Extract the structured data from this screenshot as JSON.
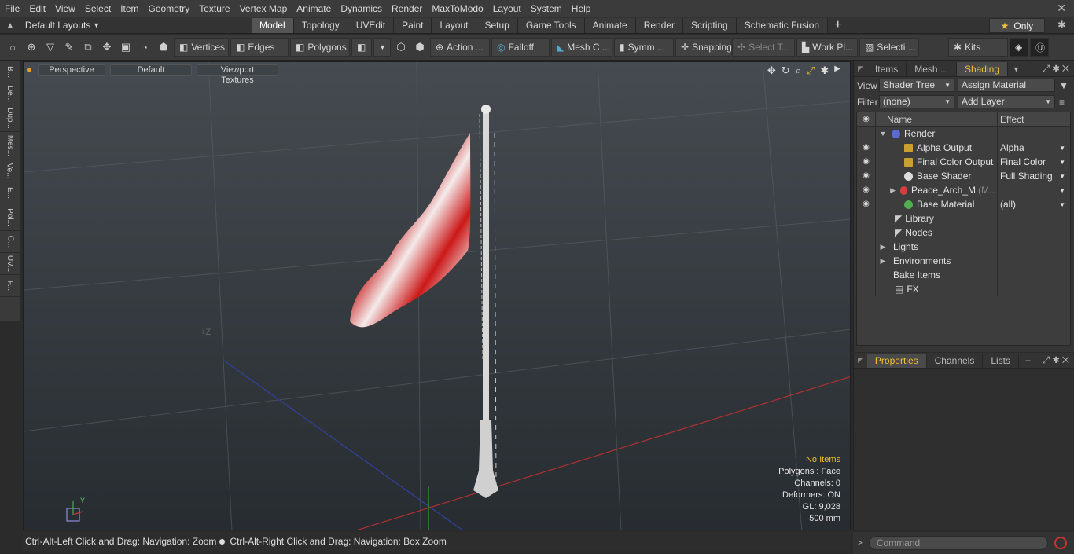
{
  "menubar": {
    "items": [
      "File",
      "Edit",
      "View",
      "Select",
      "Item",
      "Geometry",
      "Texture",
      "Vertex Map",
      "Animate",
      "Dynamics",
      "Render",
      "MaxToModo",
      "Layout",
      "System",
      "Help"
    ],
    "close": "✕"
  },
  "layout_selector": {
    "label": "Default Layouts"
  },
  "tabs": [
    "Model",
    "Topology",
    "UVEdit",
    "Paint",
    "Layout",
    "Setup",
    "Game Tools",
    "Animate",
    "Render",
    "Scripting",
    "Schematic Fusion"
  ],
  "active_tab": "Model",
  "only_button": "Only",
  "toolbar": {
    "vertices": "Vertices",
    "edges": "Edges",
    "polygons": "Polygons",
    "action": "Action ...",
    "falloff": "Falloff",
    "mesh": "Mesh C ...",
    "symm": "Symm ...",
    "snapping": "Snapping",
    "select_t": "Select T...",
    "workpl": "Work Pl...",
    "selecti": "Selecti ...",
    "kits": "Kits"
  },
  "left_tabs": [
    "B...",
    "De...",
    "Dup...",
    "Mes...",
    "Ve...",
    "E...",
    "Pol...",
    "C...",
    "UV...",
    "F..."
  ],
  "viewport": {
    "perspective": "Perspective",
    "default": "Default",
    "textures": "Viewport Textures",
    "axis_label": "+Z",
    "info": {
      "no_items": "No Items",
      "polygons": "Polygons : Face",
      "channels": "Channels: 0",
      "deformers": "Deformers: ON",
      "gl": "GL: 9,028",
      "scale": "500 mm"
    }
  },
  "status": {
    "left": "Ctrl-Alt-Left Click and Drag: Navigation: Zoom",
    "right": "Ctrl-Alt-Right Click and Drag: Navigation: Box Zoom"
  },
  "right_panel": {
    "tabs": [
      "Items",
      "Mesh ...",
      "Shading"
    ],
    "active_tab": "Shading",
    "view_label": "View",
    "view_value": "Shader Tree",
    "assign": "Assign Material",
    "filter_label": "Filter",
    "filter_value": "(none)",
    "add_layer": "Add Layer",
    "col_name": "Name",
    "col_effect": "Effect",
    "rows": [
      {
        "name": "Render",
        "effect": "",
        "color": "#5a6ad0"
      },
      {
        "name": "Alpha Output",
        "effect": "Alpha",
        "color": "#c8a030"
      },
      {
        "name": "Final Color Output",
        "effect": "Final Color",
        "color": "#c8a030"
      },
      {
        "name": "Base Shader",
        "effect": "Full Shading",
        "color": "#dddddd"
      },
      {
        "name": "Peace_Arch_M",
        "suffix": "(M...",
        "effect": "",
        "color": "#d04040"
      },
      {
        "name": "Base Material",
        "effect": "(all)",
        "color": "#50b050"
      },
      {
        "name": "Library",
        "effect": ""
      },
      {
        "name": "Nodes",
        "effect": ""
      },
      {
        "name": "Lights",
        "effect": ""
      },
      {
        "name": "Environments",
        "effect": ""
      },
      {
        "name": "Bake Items",
        "effect": ""
      },
      {
        "name": "FX",
        "effect": ""
      }
    ]
  },
  "properties_panel": {
    "tabs": [
      "Properties",
      "Channels",
      "Lists"
    ],
    "active_tab": "Properties"
  },
  "command": {
    "placeholder": "Command"
  }
}
